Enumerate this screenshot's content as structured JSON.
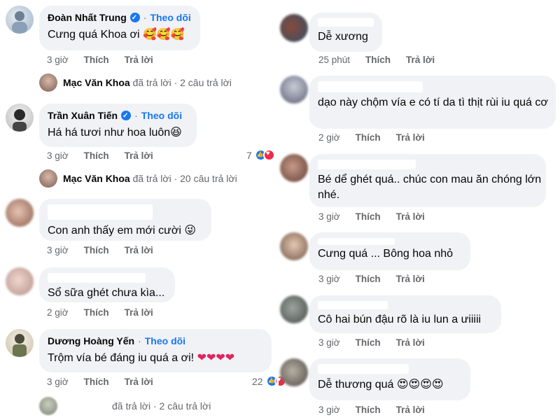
{
  "left": [
    {
      "author": "Đoàn Nhất Trung",
      "verified": true,
      "follow": "Theo dõi",
      "text": "Cưng quá Khoa ơi",
      "emoji": "🥰🥰🥰",
      "time": "3 giờ",
      "like": "Thích",
      "reply": "Trả lời",
      "reply_summary": {
        "name": "Mạc Văn Khoa",
        "text": "đã trả lời · 2 câu trả lời"
      }
    },
    {
      "author": "Trần Xuân Tiến",
      "verified": true,
      "follow": "Theo dõi",
      "text": "Há há tươi như hoa luôn",
      "emoji": "😆",
      "time": "3 giờ",
      "like": "Thích",
      "reply": "Trả lời",
      "reaction_count": "7",
      "reply_summary": {
        "name": "Mạc Văn Khoa",
        "text": "đã trả lời · 20 câu trả lời"
      }
    },
    {
      "author": "",
      "text": "Con anh thấy em mới cười",
      "emoji": "😜",
      "time": "3 giờ",
      "like": "Thích",
      "reply": "Trả lời"
    },
    {
      "author": "",
      "text": "Sổ sữa ghét chưa kìa...",
      "time": "2 giờ",
      "like": "Thích",
      "reply": "Trả lời"
    },
    {
      "author": "Dương Hoàng Yến",
      "verified": false,
      "follow": "Theo dõi",
      "text": "Trộm vía bé đáng iu quá a ơi!",
      "emoji": "❤❤❤❤",
      "time": "3 giờ",
      "like": "Thích",
      "reply": "Trả lời",
      "reaction_count": "22",
      "reply_summary": {
        "name": "",
        "text": "đã trả lời · 2 câu trả lời"
      }
    }
  ],
  "right": [
    {
      "text": "Dễ xương",
      "time": "25 phút",
      "like": "Thích",
      "reply": "Trả lời"
    },
    {
      "text": "dạo này chộm vía e có tí da tì thịt rùi iu quá cơ",
      "time": "2 giờ",
      "like": "Thích",
      "reply": "Trả lời"
    },
    {
      "text": "Bé dể ghét quá.. chúc con mau ăn chóng lớn nhé.",
      "time": "3 giờ",
      "like": "Thích",
      "reply": "Trả lời"
    },
    {
      "text": "Cưng quá ... Bông hoa nhỏ",
      "time": "3 giờ",
      "like": "Thích",
      "reply": "Trả lời"
    },
    {
      "text": "Cô hai bún đậu rõ là iu lun a ưiiiii",
      "time": "3 giờ",
      "like": "Thích",
      "reply": "Trả lời"
    },
    {
      "text": "Dễ thương quá",
      "emoji": "😍😍😍😍",
      "time": "3 giờ",
      "like": "Thích",
      "reply": "Trả lời"
    }
  ],
  "colors": {
    "bubble": "#f0f2f5",
    "link": "#1877f2",
    "muted": "#65676b",
    "heart": "#e0245e"
  }
}
